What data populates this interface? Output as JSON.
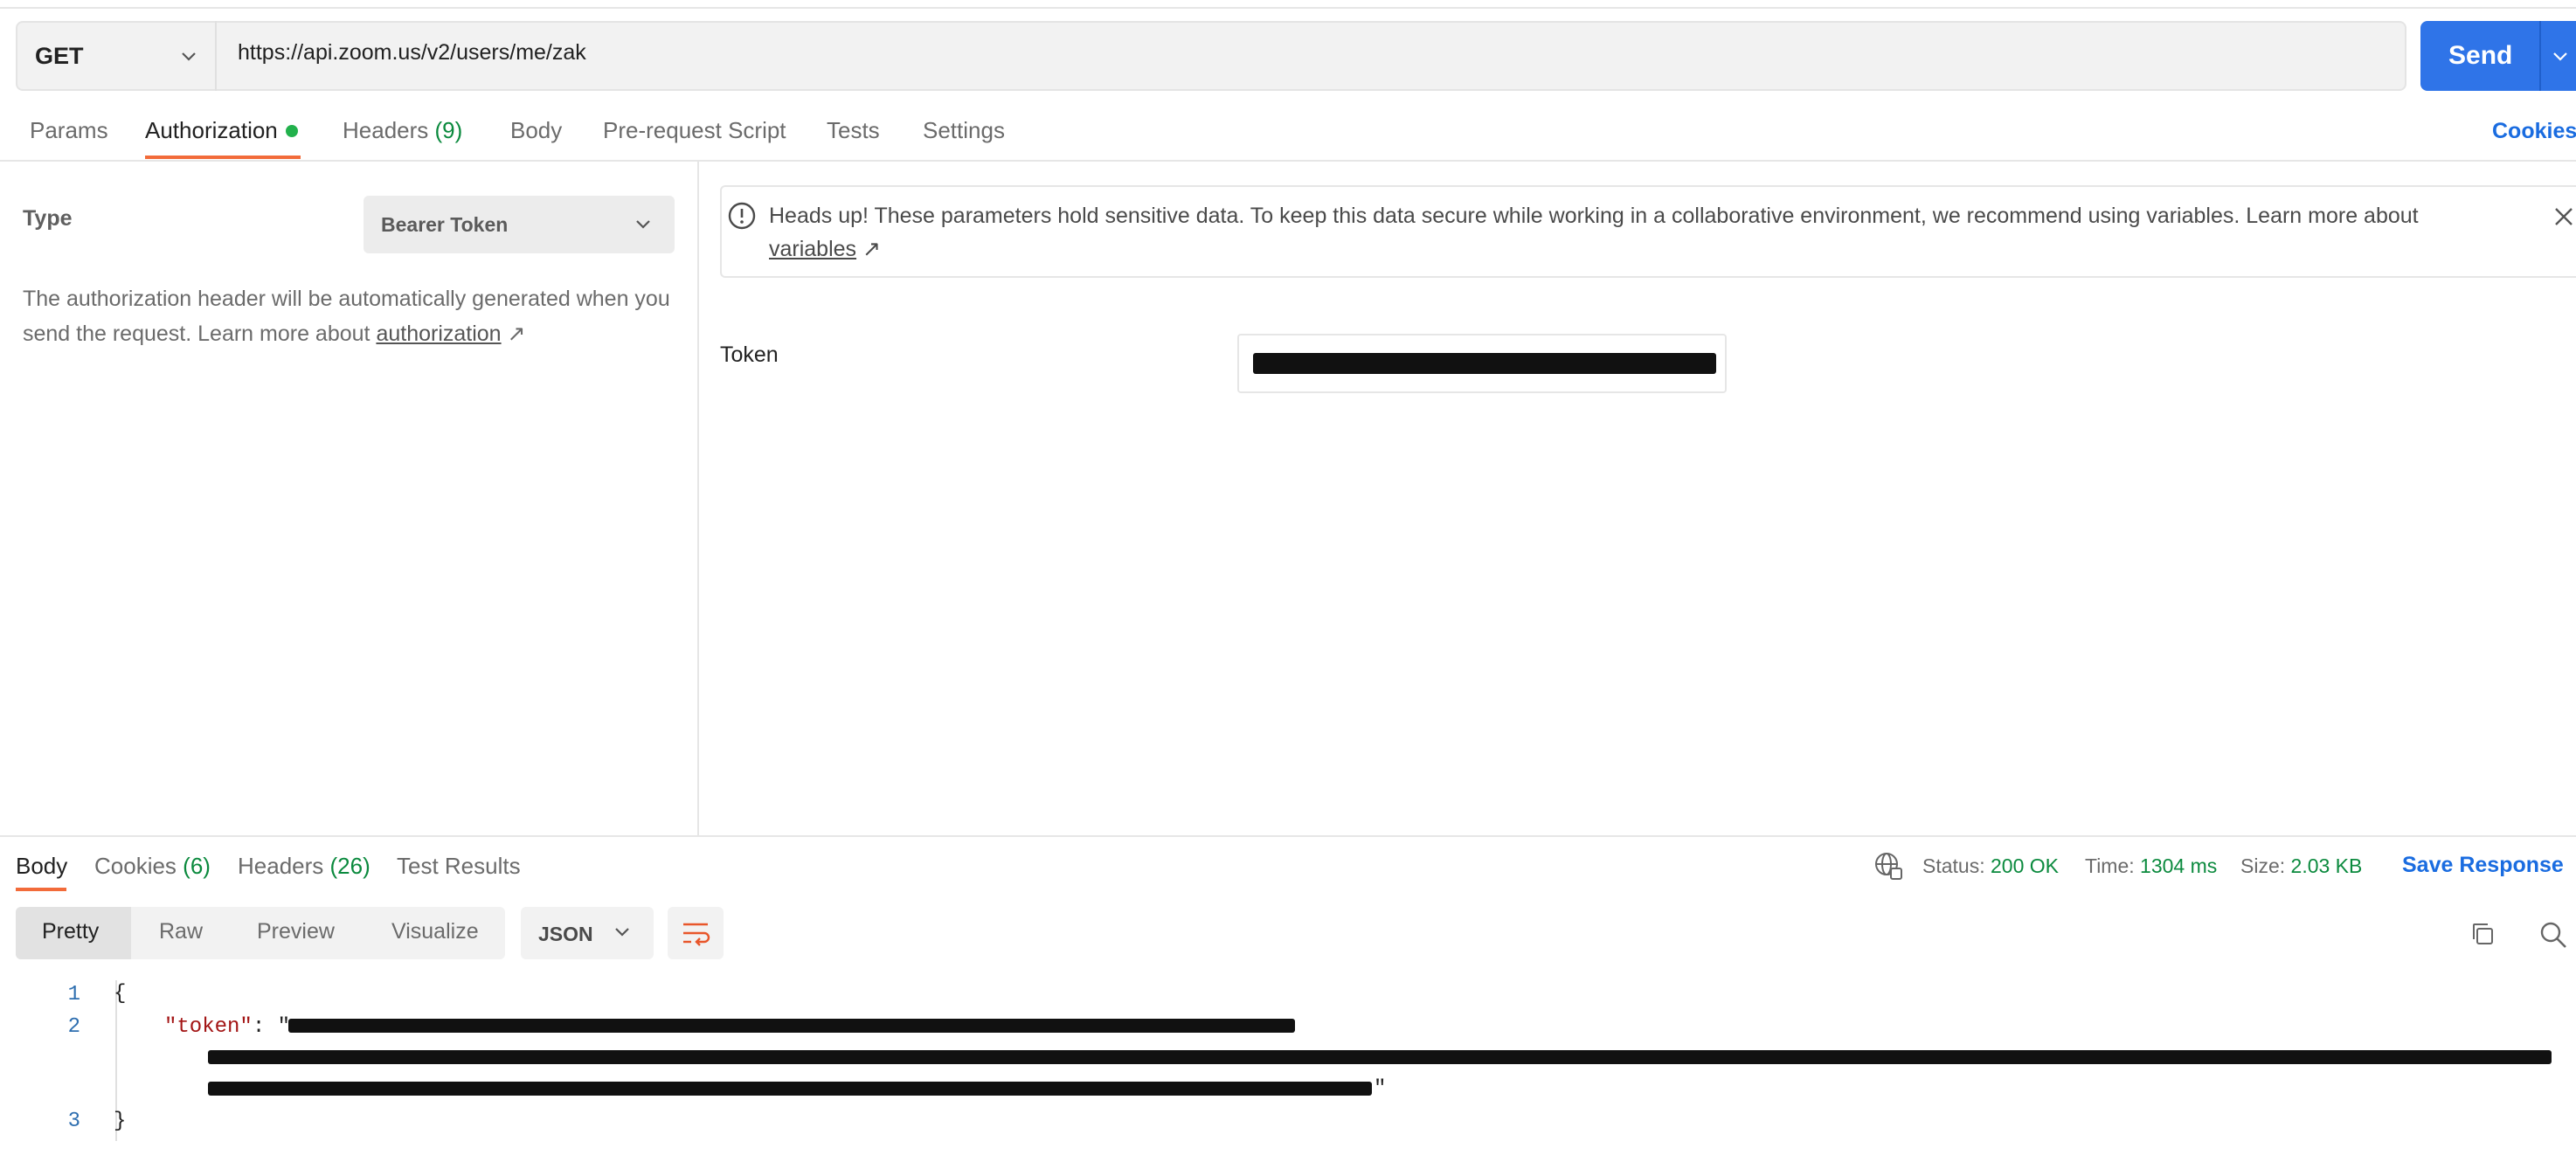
{
  "request": {
    "method": "GET",
    "url": "https://api.zoom.us/v2/users/me/zak",
    "send_label": "Send"
  },
  "request_tabs": {
    "params": "Params",
    "authorization": "Authorization",
    "headers": "Headers",
    "headers_count": "(9)",
    "body": "Body",
    "pre_request_script": "Pre-request Script",
    "tests": "Tests",
    "settings": "Settings",
    "cookies": "Cookies"
  },
  "auth": {
    "type_label": "Type",
    "type_value": "Bearer Token",
    "description_prefix": "The authorization header will be automatically generated when you send the request. Learn more about ",
    "description_link": "authorization",
    "link_arrow": "↗",
    "warning_text": "Heads up! These parameters hold sensitive data. To keep this data secure while working in a collaborative environment, we recommend using variables. Learn more about",
    "warning_link": "variables",
    "token_label": "Token"
  },
  "response": {
    "tabs": {
      "body": "Body",
      "cookies": "Cookies",
      "cookies_count": "(6)",
      "headers": "Headers",
      "headers_count": "(26)",
      "test_results": "Test Results"
    },
    "status_label": "Status:",
    "status_value": "200 OK",
    "time_label": "Time:",
    "time_value": "1304 ms",
    "size_label": "Size:",
    "size_value": "2.03 KB",
    "save_label": "Save Response",
    "views": [
      "Pretty",
      "Raw",
      "Preview",
      "Visualize"
    ],
    "format": "JSON",
    "lines": [
      {
        "num": "1",
        "text": "{"
      },
      {
        "num": "2",
        "key": "\"token\"",
        "sep": ": \""
      },
      {
        "num": "3",
        "text": "}"
      }
    ],
    "closing_quote": "\""
  },
  "colors": {
    "accent_orange": "#f26b3a",
    "send_blue": "#2f74e8",
    "link_blue": "#1a6ce0",
    "success_green": "#0b8a3e"
  }
}
